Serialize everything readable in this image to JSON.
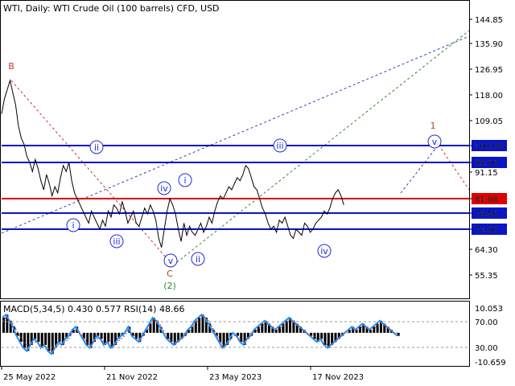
{
  "chart_data": [
    {
      "type": "line",
      "title": "WTI, Daily:  WTI Crude Oil (100 barrels) CFD, USD",
      "y_ticks": [
        "144.85",
        "135.90",
        "126.95",
        "118.00",
        "109.05",
        "100.00",
        "94.00",
        "91.15",
        "81.08",
        "76.50",
        "71.00",
        "64.30",
        "55.35"
      ],
      "x_ticks": [
        "25 May 2022",
        "21 Nov 2022",
        "23 May 2023",
        "17 Nov 2023"
      ],
      "ylim": [
        51.5,
        149.0
      ],
      "grid": false,
      "price": {
        "x": [
          0,
          3,
          6,
          9,
          12,
          15,
          18,
          21,
          24,
          27,
          30,
          33,
          36,
          39,
          42,
          45,
          48,
          51,
          54,
          57,
          60,
          63,
          66,
          69,
          72,
          75,
          78,
          81,
          84,
          87,
          90,
          93,
          96,
          99,
          102,
          105,
          108,
          111,
          114,
          117,
          120,
          123,
          126,
          129,
          132,
          135,
          138,
          141,
          144,
          147,
          150,
          153,
          156,
          159,
          162,
          165,
          168,
          171,
          174,
          177,
          180,
          183,
          186,
          189,
          192,
          195,
          198,
          201,
          204,
          207,
          210,
          213,
          216,
          219,
          222,
          225,
          228,
          231,
          234,
          237,
          240,
          243,
          246,
          249,
          252,
          255,
          258,
          261,
          264,
          267,
          270,
          273,
          276,
          279,
          282,
          285,
          288,
          291,
          294,
          297,
          300,
          303,
          306,
          309,
          312,
          315,
          318,
          321,
          324,
          327,
          330,
          333,
          336,
          339,
          342,
          345,
          348,
          351,
          354,
          357,
          360,
          363,
          366,
          369,
          372,
          375,
          378,
          381,
          384,
          387,
          390,
          393,
          396,
          399,
          402,
          405,
          408,
          411,
          414,
          417,
          420,
          423,
          426,
          429,
          432,
          435,
          438,
          441,
          444,
          447,
          450,
          453,
          456,
          459,
          462,
          465,
          468,
          471,
          474,
          477,
          480,
          483,
          486,
          489,
          492,
          495,
          498
        ],
        "values": [
          112,
          117,
          120,
          123,
          119,
          115,
          108,
          104,
          102,
          98,
          96,
          93,
          97,
          94,
          90,
          87,
          92,
          89,
          85,
          88,
          86,
          91,
          95,
          93,
          96,
          90,
          86,
          84,
          82,
          80,
          78,
          76,
          80,
          78,
          76,
          74,
          77,
          75,
          80,
          78,
          82,
          81,
          79,
          83,
          80,
          76,
          78,
          80,
          76,
          75,
          78,
          81,
          79,
          82,
          80,
          77,
          71,
          68,
          74,
          80,
          84,
          82,
          79,
          74,
          70,
          76,
          72,
          75,
          73,
          72,
          74,
          76,
          73,
          75,
          78,
          76,
          80,
          83,
          85,
          84,
          86,
          88,
          87,
          89,
          91,
          90,
          92,
          95,
          94,
          91,
          88,
          87,
          84,
          81,
          79,
          76,
          74,
          75,
          73,
          77,
          76,
          78,
          75,
          72,
          71,
          74,
          73,
          72,
          76,
          75,
          73,
          74,
          76,
          77,
          78,
          80,
          79,
          81,
          84,
          86,
          87,
          85,
          82
        ],
        "color": "#000000"
      },
      "levels": [
        {
          "label": "100.00",
          "value": 100.0,
          "color": "#0a14c8"
        },
        {
          "label": "94.00",
          "value": 94.0,
          "color": "#0a14c8"
        },
        {
          "label": "81.08",
          "value": 81.08,
          "color": "#e00000"
        },
        {
          "label": "76.50",
          "value": 76.5,
          "color": "#0a14c8"
        },
        {
          "label": "71.00",
          "value": 71.0,
          "color": "#0a14c8"
        }
      ],
      "wave_labels": [
        {
          "text": "B",
          "color": "#c0392b",
          "circled": false
        },
        {
          "text": "ii",
          "color": "#1f2bd6",
          "circled": true
        },
        {
          "text": "i",
          "color": "#1f2bd6",
          "circled": true
        },
        {
          "text": "iii",
          "color": "#1f2bd6",
          "circled": true
        },
        {
          "text": "iv",
          "color": "#1f2bd6",
          "circled": true
        },
        {
          "text": "i",
          "color": "#1f2bd6",
          "circled": true
        },
        {
          "text": "v",
          "color": "#1f2bd6",
          "circled": true
        },
        {
          "text": "C",
          "color": "#c0392b",
          "circled": false
        },
        {
          "text": "(2)",
          "color": "#2e8b2e",
          "circled": false
        },
        {
          "text": "ii",
          "color": "#1f2bd6",
          "circled": true
        },
        {
          "text": "iii",
          "color": "#1f2bd6",
          "circled": true
        },
        {
          "text": "iv",
          "color": "#1f2bd6",
          "circled": true
        },
        {
          "text": "1",
          "color": "#c0392b",
          "circled": false
        },
        {
          "text": "v",
          "color": "#1f2bd6",
          "circled": true
        }
      ]
    },
    {
      "type": "line",
      "title": "MACD(5,34,5) 0.430 0.577 RSI(14) 48.66",
      "y_ticks": [
        "10.053",
        "70.00",
        "30.00",
        "-10.659"
      ],
      "ylim": [
        -10.659,
        10.053
      ],
      "series": [
        {
          "values": [
            5,
            6,
            4,
            2,
            -1,
            -3,
            -5,
            -6,
            -4,
            -2,
            -3,
            -5,
            -4,
            -6,
            -7,
            -5,
            -3,
            -4,
            -2,
            -1,
            1,
            2,
            0,
            -2,
            -4,
            -5,
            -3,
            -1,
            -2,
            -4,
            -3,
            -5,
            -4,
            -2,
            -1,
            0,
            2,
            -1,
            -2,
            -3,
            -1,
            1,
            3,
            5,
            4,
            2,
            0,
            -2,
            -3,
            -4,
            -3,
            -2,
            -1,
            1,
            2,
            4,
            5,
            6,
            5,
            3,
            1,
            -1,
            -3,
            -5,
            -4,
            -2,
            0,
            -1,
            -3,
            -4,
            -2,
            -1,
            1,
            2,
            3,
            4,
            3,
            2,
            1,
            2,
            3,
            4,
            5,
            4,
            3,
            2,
            1,
            0,
            -1,
            -2,
            -3,
            -2,
            -4,
            -5,
            -4,
            -3,
            -2,
            -1,
            0,
            1,
            2,
            1,
            2,
            3,
            2,
            1,
            2,
            3,
            4,
            3,
            2,
            1,
            0,
            -1
          ],
          "color": "#1e90ff"
        },
        {
          "values": [
            4,
            5,
            4,
            3,
            1,
            -1,
            -3,
            -4,
            -4,
            -3,
            -3,
            -4,
            -4,
            -5,
            -6,
            -5,
            -4,
            -4,
            -3,
            -2,
            0,
            1,
            0,
            -1,
            -3,
            -4,
            -3,
            -2,
            -2,
            -3,
            -3,
            -4,
            -4,
            -3,
            -2,
            -1,
            1,
            0,
            -1,
            -2,
            -1,
            0,
            2,
            4,
            4,
            3,
            1,
            -1,
            -2,
            -3,
            -3,
            -2,
            -1,
            0,
            1,
            3,
            4,
            5,
            5,
            4,
            2,
            0,
            -2,
            -4,
            -4,
            -3,
            -1,
            -1,
            -2,
            -3,
            -2,
            -1,
            0,
            1,
            2,
            3,
            3,
            2,
            1,
            1,
            2,
            3,
            4,
            4,
            3,
            2,
            1,
            0,
            -1,
            -1,
            -2,
            -2,
            -3,
            -4,
            -4,
            -3,
            -2,
            -1,
            0,
            0,
            1,
            1,
            1,
            2,
            2,
            1,
            1,
            2,
            3,
            3,
            2,
            1,
            0,
            0
          ],
          "color": "#c0392b"
        }
      ]
    }
  ],
  "time_axis": [
    "25 May 2022",
    "21 Nov 2022",
    "23 May 2023",
    "17 Nov 2023"
  ]
}
